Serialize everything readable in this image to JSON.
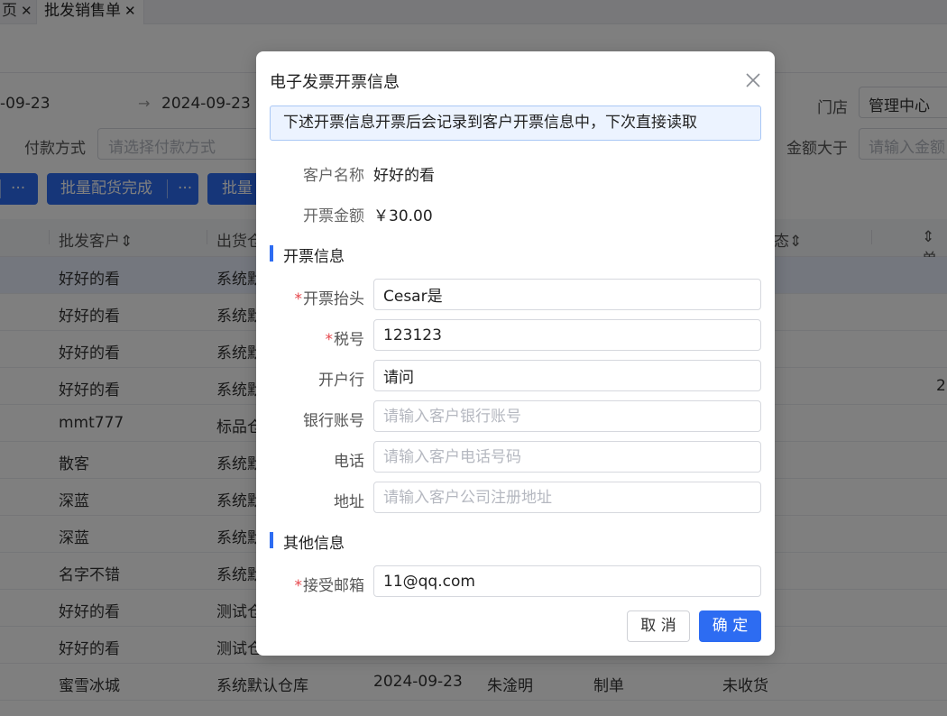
{
  "tabs": [
    {
      "label": "页",
      "close": "✕"
    },
    {
      "label": "批发销售单",
      "close": "✕"
    }
  ],
  "filters": {
    "date_start": "-09-23",
    "date_arrow": "→",
    "date_end": "2024-09-23",
    "store_label": "门店",
    "store_value": "管理中心",
    "pay_label": "付款方式",
    "pay_placeholder": "请选择付款方式",
    "amount_label": "金额大于",
    "amount_placeholder": "请输入金额"
  },
  "actions": {
    "more1": "···",
    "batch_done": "批量配货完成",
    "more2": "···",
    "batch_other": "批量"
  },
  "table": {
    "headers": [
      "批发客户⇕",
      "出货仓",
      "态⇕",
      "⇕单"
    ],
    "rows": [
      {
        "customer": "好好的看",
        "warehouse": "系统默",
        "extra": ""
      },
      {
        "customer": "好好的看",
        "warehouse": "系统默",
        "extra": ""
      },
      {
        "customer": "好好的看",
        "warehouse": "系统默",
        "extra": ""
      },
      {
        "customer": "好好的看",
        "warehouse": "系统默",
        "extra": "2"
      },
      {
        "customer": "mmt777",
        "warehouse": "标品仓",
        "extra": ""
      },
      {
        "customer": "散客",
        "warehouse": "系统默",
        "extra": ""
      },
      {
        "customer": "深蓝",
        "warehouse": "系统默",
        "extra": ""
      },
      {
        "customer": "深蓝",
        "warehouse": "系统默",
        "extra": ""
      },
      {
        "customer": "名字不错",
        "warehouse": "系统默",
        "extra": ""
      },
      {
        "customer": "好好的看",
        "warehouse": "测试仓",
        "extra": ""
      },
      {
        "customer": "好好的看",
        "warehouse": "测试仓",
        "extra": ""
      },
      {
        "customer": "蜜雪冰城",
        "warehouse": "系统默认仓库",
        "date": "2024-09-23",
        "person": "朱淦明",
        "type": "制单",
        "status": "未收货",
        "extra": ""
      }
    ]
  },
  "dialog": {
    "title": "电子发票开票信息",
    "notice": "下述开票信息开票后会记录到客户开票信息中，下次直接读取",
    "customer_label": "客户名称",
    "customer_value": "好好的看",
    "amount_label": "开票金额",
    "amount_value": "￥30.00",
    "section_invoice": "开票信息",
    "fields": {
      "title_label": "开票抬头",
      "title_value": "Cesar是",
      "tax_label": "税号",
      "tax_value": "123123",
      "bank_label": "开户行",
      "bank_value": "请问",
      "account_label": "银行账号",
      "account_placeholder": "请输入客户银行账号",
      "phone_label": "电话",
      "phone_placeholder": "请输入客户电话号码",
      "address_label": "地址",
      "address_placeholder": "请输入客户公司注册地址"
    },
    "required_mark": "*",
    "section_other": "其他信息",
    "email_label": "接受邮箱",
    "email_value": "11@qq.com",
    "cancel": "取 消",
    "ok": "确 定"
  }
}
